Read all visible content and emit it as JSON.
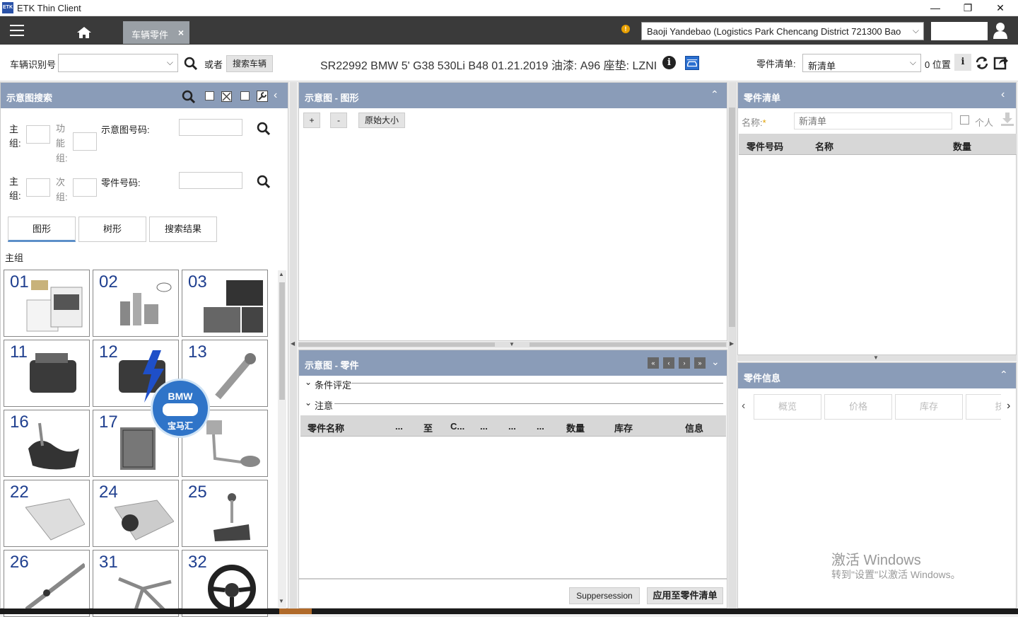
{
  "window": {
    "title": "ETK Thin Client",
    "logo": "ETK"
  },
  "topbar": {
    "tab_label": "车辆零件",
    "dealer": "Baoji Yandebao (Logistics Park Chencang District 721300 Bao",
    "warning_glyph": "!"
  },
  "vehicle_bar": {
    "vin_label": "车辆识别号",
    "or_label": "或者",
    "search_vehicle_button": "搜索车辆",
    "vehicle_info": "SR22992 BMW 5' G38 530Li B48 01.21.2019 油漆: A96 座垫: LZNI",
    "parts_list_label": "零件清单:",
    "parts_list_value": "新清单",
    "positions": "0 位置"
  },
  "diagram_search": {
    "title": "示意图搜索",
    "row1": {
      "main_group": "主组:",
      "func_group": "功能组:",
      "diagram_no": "示意图号码:"
    },
    "row2": {
      "main_group": "主组:",
      "sub_group": "次组:",
      "part_no": "零件号码:"
    },
    "tabs": [
      "图形",
      "树形",
      "搜索结果"
    ],
    "section_label": "主组",
    "tiles": [
      "01",
      "02",
      "03",
      "11",
      "12",
      "13",
      "16",
      "17",
      "",
      "22",
      "24",
      "25",
      "26",
      "31",
      "32"
    ]
  },
  "diagram_graphic": {
    "title": "示意图 - 图形",
    "zoom_in": "+",
    "zoom_out": "-",
    "original_size": "原始大小"
  },
  "diagram_parts": {
    "title": "示意图 - 零件",
    "condition_label": "条件评定",
    "notes_label": "注意",
    "columns": [
      "零件名称",
      "...",
      "至",
      "C...",
      "...",
      "...",
      "...",
      "数量",
      "库存",
      "信息"
    ],
    "suppersession_button": "Suppersession",
    "apply_button": "应用至零件清单"
  },
  "parts_list": {
    "title": "零件清单",
    "name_label": "名称:",
    "required_mark": "*",
    "name_placeholder": "新清单",
    "personal_label": "个人",
    "columns": [
      "零件号码",
      "名称",
      "数量"
    ]
  },
  "part_info": {
    "title": "零件信息",
    "tabs": [
      "概览",
      "价格",
      "库存",
      "技"
    ]
  },
  "watermark": {
    "line1": "激活 Windows",
    "line2": "转到\"设置\"以激活 Windows。"
  },
  "bmw_logo": {
    "text": "BMW",
    "subtext": "宝马汇"
  }
}
